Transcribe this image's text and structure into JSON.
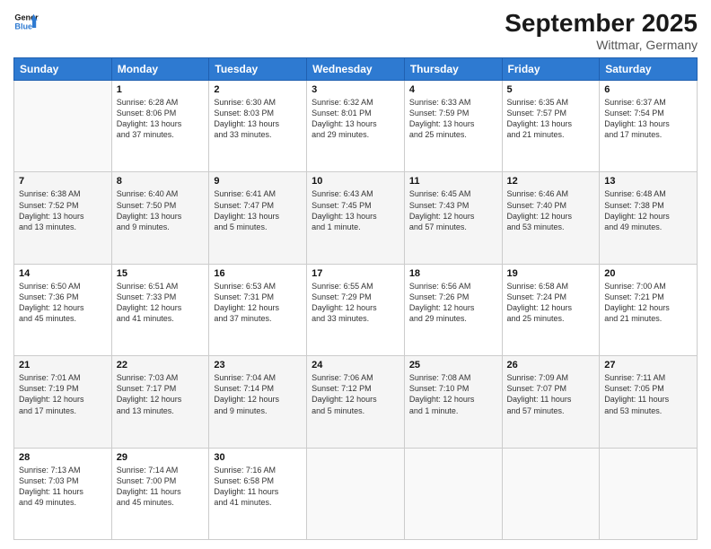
{
  "header": {
    "logo_line1": "General",
    "logo_line2": "Blue",
    "month": "September 2025",
    "location": "Wittmar, Germany"
  },
  "days_of_week": [
    "Sunday",
    "Monday",
    "Tuesday",
    "Wednesday",
    "Thursday",
    "Friday",
    "Saturday"
  ],
  "weeks": [
    [
      {
        "day": "",
        "info": ""
      },
      {
        "day": "1",
        "info": "Sunrise: 6:28 AM\nSunset: 8:06 PM\nDaylight: 13 hours\nand 37 minutes."
      },
      {
        "day": "2",
        "info": "Sunrise: 6:30 AM\nSunset: 8:03 PM\nDaylight: 13 hours\nand 33 minutes."
      },
      {
        "day": "3",
        "info": "Sunrise: 6:32 AM\nSunset: 8:01 PM\nDaylight: 13 hours\nand 29 minutes."
      },
      {
        "day": "4",
        "info": "Sunrise: 6:33 AM\nSunset: 7:59 PM\nDaylight: 13 hours\nand 25 minutes."
      },
      {
        "day": "5",
        "info": "Sunrise: 6:35 AM\nSunset: 7:57 PM\nDaylight: 13 hours\nand 21 minutes."
      },
      {
        "day": "6",
        "info": "Sunrise: 6:37 AM\nSunset: 7:54 PM\nDaylight: 13 hours\nand 17 minutes."
      }
    ],
    [
      {
        "day": "7",
        "info": "Sunrise: 6:38 AM\nSunset: 7:52 PM\nDaylight: 13 hours\nand 13 minutes."
      },
      {
        "day": "8",
        "info": "Sunrise: 6:40 AM\nSunset: 7:50 PM\nDaylight: 13 hours\nand 9 minutes."
      },
      {
        "day": "9",
        "info": "Sunrise: 6:41 AM\nSunset: 7:47 PM\nDaylight: 13 hours\nand 5 minutes."
      },
      {
        "day": "10",
        "info": "Sunrise: 6:43 AM\nSunset: 7:45 PM\nDaylight: 13 hours\nand 1 minute."
      },
      {
        "day": "11",
        "info": "Sunrise: 6:45 AM\nSunset: 7:43 PM\nDaylight: 12 hours\nand 57 minutes."
      },
      {
        "day": "12",
        "info": "Sunrise: 6:46 AM\nSunset: 7:40 PM\nDaylight: 12 hours\nand 53 minutes."
      },
      {
        "day": "13",
        "info": "Sunrise: 6:48 AM\nSunset: 7:38 PM\nDaylight: 12 hours\nand 49 minutes."
      }
    ],
    [
      {
        "day": "14",
        "info": "Sunrise: 6:50 AM\nSunset: 7:36 PM\nDaylight: 12 hours\nand 45 minutes."
      },
      {
        "day": "15",
        "info": "Sunrise: 6:51 AM\nSunset: 7:33 PM\nDaylight: 12 hours\nand 41 minutes."
      },
      {
        "day": "16",
        "info": "Sunrise: 6:53 AM\nSunset: 7:31 PM\nDaylight: 12 hours\nand 37 minutes."
      },
      {
        "day": "17",
        "info": "Sunrise: 6:55 AM\nSunset: 7:29 PM\nDaylight: 12 hours\nand 33 minutes."
      },
      {
        "day": "18",
        "info": "Sunrise: 6:56 AM\nSunset: 7:26 PM\nDaylight: 12 hours\nand 29 minutes."
      },
      {
        "day": "19",
        "info": "Sunrise: 6:58 AM\nSunset: 7:24 PM\nDaylight: 12 hours\nand 25 minutes."
      },
      {
        "day": "20",
        "info": "Sunrise: 7:00 AM\nSunset: 7:21 PM\nDaylight: 12 hours\nand 21 minutes."
      }
    ],
    [
      {
        "day": "21",
        "info": "Sunrise: 7:01 AM\nSunset: 7:19 PM\nDaylight: 12 hours\nand 17 minutes."
      },
      {
        "day": "22",
        "info": "Sunrise: 7:03 AM\nSunset: 7:17 PM\nDaylight: 12 hours\nand 13 minutes."
      },
      {
        "day": "23",
        "info": "Sunrise: 7:04 AM\nSunset: 7:14 PM\nDaylight: 12 hours\nand 9 minutes."
      },
      {
        "day": "24",
        "info": "Sunrise: 7:06 AM\nSunset: 7:12 PM\nDaylight: 12 hours\nand 5 minutes."
      },
      {
        "day": "25",
        "info": "Sunrise: 7:08 AM\nSunset: 7:10 PM\nDaylight: 12 hours\nand 1 minute."
      },
      {
        "day": "26",
        "info": "Sunrise: 7:09 AM\nSunset: 7:07 PM\nDaylight: 11 hours\nand 57 minutes."
      },
      {
        "day": "27",
        "info": "Sunrise: 7:11 AM\nSunset: 7:05 PM\nDaylight: 11 hours\nand 53 minutes."
      }
    ],
    [
      {
        "day": "28",
        "info": "Sunrise: 7:13 AM\nSunset: 7:03 PM\nDaylight: 11 hours\nand 49 minutes."
      },
      {
        "day": "29",
        "info": "Sunrise: 7:14 AM\nSunset: 7:00 PM\nDaylight: 11 hours\nand 45 minutes."
      },
      {
        "day": "30",
        "info": "Sunrise: 7:16 AM\nSunset: 6:58 PM\nDaylight: 11 hours\nand 41 minutes."
      },
      {
        "day": "",
        "info": ""
      },
      {
        "day": "",
        "info": ""
      },
      {
        "day": "",
        "info": ""
      },
      {
        "day": "",
        "info": ""
      }
    ]
  ]
}
